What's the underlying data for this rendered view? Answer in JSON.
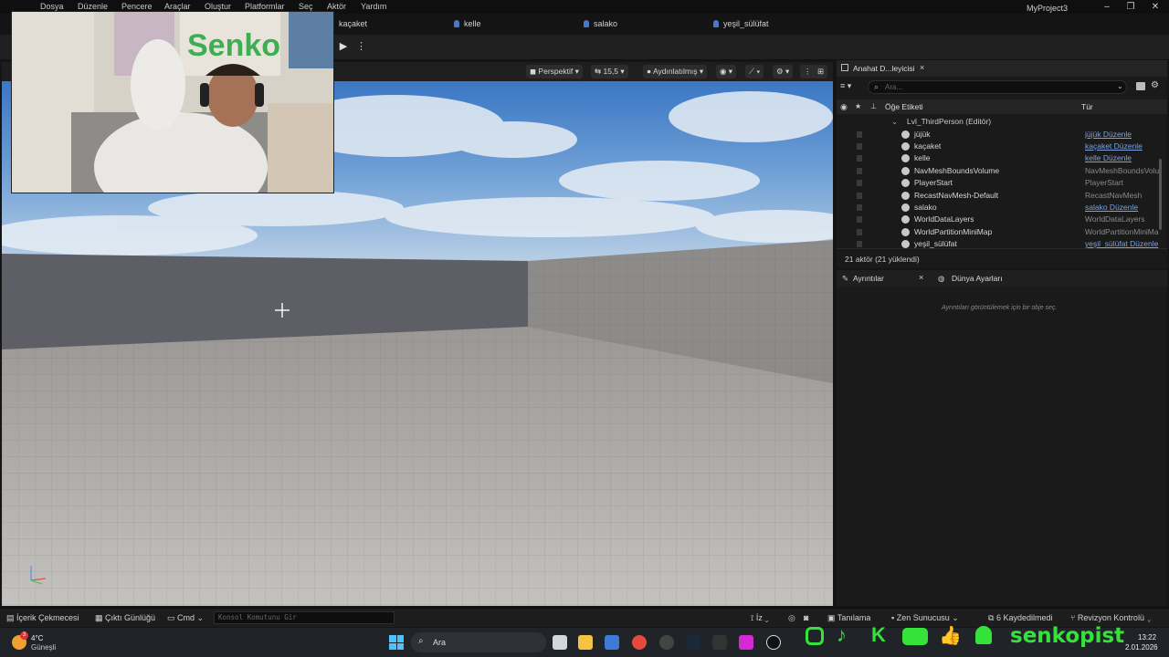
{
  "menubar": {
    "items": [
      "Dosya",
      "Düzenle",
      "Pencere",
      "Araçlar",
      "Oluştur",
      "Platformlar",
      "Seç",
      "Aktör",
      "Yardım"
    ],
    "project_title": "MyProject3"
  },
  "tabs": {
    "users": [
      "kaçaket",
      "kelle",
      "salako",
      "yeşil_sülüfat"
    ]
  },
  "viewport": {
    "perspective": "Perspektif",
    "fov": "15,5",
    "lighting": "Aydınlatılmış"
  },
  "outliner": {
    "tab_title": "Anahat D...leyicisi",
    "search_placeholder": "Ara...",
    "col_label": "Öğe Etiketi",
    "col_type": "Tür",
    "level": "Lvl_ThirdPerson (Editör)",
    "rows": [
      {
        "label": "jüjük",
        "type": "jüjük Düzenle",
        "link": true,
        "icon": "person-icon"
      },
      {
        "label": "kaçaket",
        "type": "kaçaket Düzenle",
        "link": true,
        "icon": "person-icon"
      },
      {
        "label": "kelle",
        "type": "kelle Düzenle",
        "link": true,
        "icon": "person-icon"
      },
      {
        "label": "NavMeshBoundsVolume",
        "type": "NavMeshBoundsVolu",
        "link": false,
        "icon": "volume-icon"
      },
      {
        "label": "PlayerStart",
        "type": "PlayerStart",
        "link": false,
        "icon": "person-icon"
      },
      {
        "label": "RecastNavMesh-Default",
        "type": "RecastNavMesh",
        "link": false,
        "icon": "actor-icon"
      },
      {
        "label": "salako",
        "type": "salako Düzenle",
        "link": true,
        "icon": "person-icon"
      },
      {
        "label": "WorldDataLayers",
        "type": "WorldDataLayers",
        "link": false,
        "icon": "layers-icon"
      },
      {
        "label": "WorldPartitionMiniMap",
        "type": "WorldPartitionMiniMa",
        "link": false,
        "icon": "actor-icon"
      },
      {
        "label": "yeşil_sülüfat",
        "type": "yeşil_sülüfat Düzenle",
        "link": true,
        "icon": "person-icon"
      }
    ],
    "footer": "21 aktör (21 yüklendi)"
  },
  "details": {
    "tab_details": "Ayrıntılar",
    "tab_world": "Dünya Ayarları",
    "empty_msg": "Ayrıntıları görüntülemek için bir obje seç."
  },
  "bottombar": {
    "content_drawer": "İçerik Çekmecesi",
    "output_log": "Çıktı Günlüğü",
    "cmd": "Cmd",
    "console_placeholder": "Konsol Komutunu Gir",
    "trace": "İz",
    "derive": "Tanılama",
    "zen": "Zen Sunucusu",
    "saved": "6 Kaydedilmedi",
    "revision": "Revizyon Kontrolü"
  },
  "taskbar": {
    "weather_temp": "4°C",
    "weather_desc": "Güneşli",
    "weather_badge": "3",
    "search": "Ara",
    "time": "13:22",
    "date": "2.01.2026"
  },
  "overlay": {
    "channel_name": "senkopist"
  },
  "colors": {
    "link": "#7da4e0",
    "accent": "#2f6fd6",
    "social_green": "#35e23a"
  }
}
